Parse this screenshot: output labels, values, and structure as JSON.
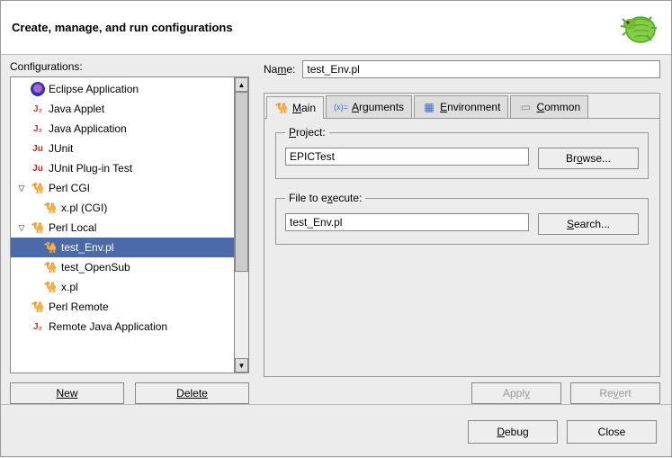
{
  "header": {
    "title": "Create, manage, and run configurations"
  },
  "left": {
    "label": "Configurations:",
    "new_btn": "New",
    "delete_btn": "Delete",
    "nodes": [
      {
        "label": "Eclipse Application",
        "icon": "eclipse",
        "depth": 1,
        "twisty": ""
      },
      {
        "label": "Java Applet",
        "icon": "java",
        "depth": 1,
        "twisty": ""
      },
      {
        "label": "Java Application",
        "icon": "java",
        "depth": 1,
        "twisty": ""
      },
      {
        "label": "JUnit",
        "icon": "ju",
        "depth": 1,
        "twisty": ""
      },
      {
        "label": "JUnit Plug-in Test",
        "icon": "ju",
        "depth": 1,
        "twisty": ""
      },
      {
        "label": "Perl CGI",
        "icon": "camel",
        "depth": 1,
        "twisty": "▽"
      },
      {
        "label": "x.pl (CGI)",
        "icon": "camel",
        "depth": 2,
        "twisty": ""
      },
      {
        "label": "Perl Local",
        "icon": "camel",
        "depth": 1,
        "twisty": "▽"
      },
      {
        "label": "test_Env.pl",
        "icon": "camel",
        "depth": 2,
        "twisty": "",
        "selected": true
      },
      {
        "label": "test_OpenSub",
        "icon": "camel",
        "depth": 2,
        "twisty": ""
      },
      {
        "label": "x.pl",
        "icon": "camel",
        "depth": 2,
        "twisty": ""
      },
      {
        "label": "Perl Remote",
        "icon": "camel",
        "depth": 1,
        "twisty": ""
      },
      {
        "label": "Remote Java Application",
        "icon": "java",
        "depth": 1,
        "twisty": ""
      }
    ]
  },
  "right": {
    "name_label_pre": "Na",
    "name_label_u": "m",
    "name_label_post": "e:",
    "name_value": "test_Env.pl",
    "tabs": [
      {
        "label": "Main",
        "icon": "camel",
        "active": true,
        "u": "M"
      },
      {
        "label": "Arguments",
        "icon": "args",
        "u": "A"
      },
      {
        "label": "Environment",
        "icon": "env",
        "u": "E"
      },
      {
        "label": "Common",
        "icon": "common",
        "u": "C"
      }
    ],
    "project": {
      "legend_pre": "",
      "legend_u": "P",
      "legend_post": "roject:",
      "value": "EPICTest",
      "btn_pre": "Br",
      "btn_u": "o",
      "btn_post": "wse..."
    },
    "file": {
      "legend_pre": "File to e",
      "legend_u": "x",
      "legend_post": "ecute:",
      "value": "test_Env.pl",
      "btn_pre": "",
      "btn_u": "S",
      "btn_post": "earch..."
    },
    "apply": {
      "pre": "Appl",
      "u": "y",
      "post": ""
    },
    "revert": {
      "pre": "Re",
      "u": "v",
      "post": "ert"
    }
  },
  "footer": {
    "debug": {
      "pre": "",
      "u": "D",
      "post": "ebug"
    },
    "close": "Close"
  }
}
